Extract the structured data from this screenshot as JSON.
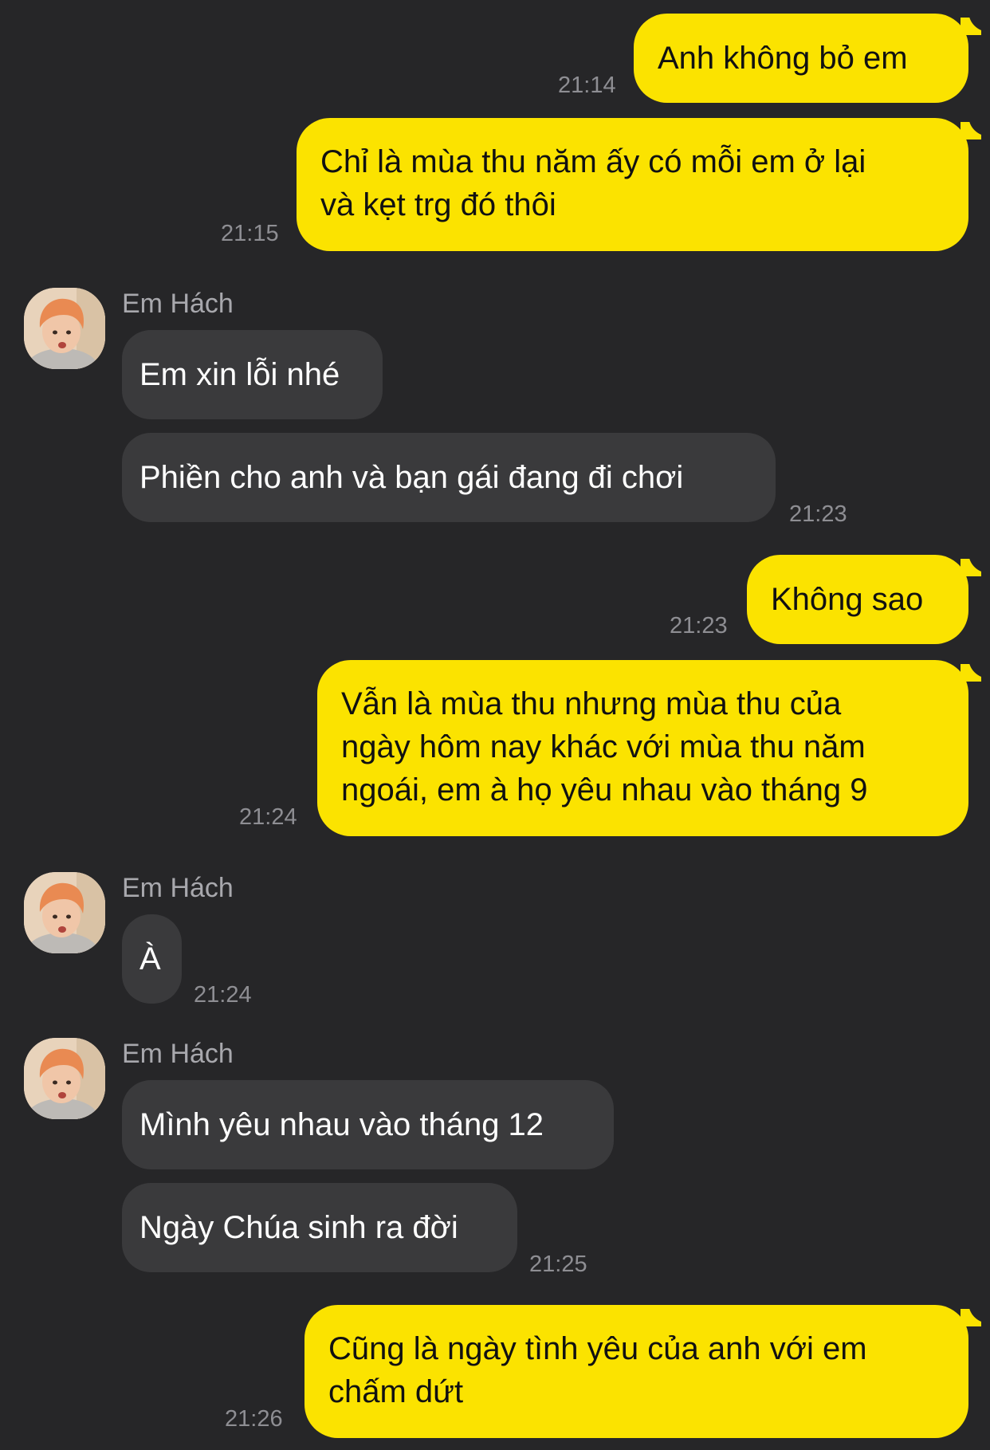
{
  "colors": {
    "background": "#262628",
    "outgoing_bubble": "#fbe300",
    "incoming_bubble": "#3a3a3c",
    "timestamp": "#8e8e93"
  },
  "contact": {
    "name": "Em Hách",
    "avatar_icon": "profile-photo-icon"
  },
  "messages": [
    {
      "from": "me",
      "lines": [
        "Anh không bỏ em"
      ],
      "time": "21:14"
    },
    {
      "from": "me",
      "lines": [
        "Chỉ là mùa thu năm ấy có mỗi em ở lại",
        "và kẹt trg đó thôi"
      ],
      "time": "21:15"
    },
    {
      "from": "contact",
      "sender": "Em Hách",
      "lines": [
        "Em xin lỗi nhé"
      ]
    },
    {
      "from": "contact",
      "lines": [
        "Phiền cho anh và bạn gái đang đi chơi"
      ],
      "time": "21:23"
    },
    {
      "from": "me",
      "lines": [
        "Không sao"
      ],
      "time": "21:23"
    },
    {
      "from": "me",
      "lines": [
        "Vẫn là mùa thu nhưng mùa thu của",
        "ngày hôm nay khác với mùa thu năm",
        "ngoái, em à họ yêu nhau vào tháng 9"
      ],
      "time": "21:24"
    },
    {
      "from": "contact",
      "sender": "Em Hách",
      "lines": [
        "À"
      ],
      "time": "21:24"
    },
    {
      "from": "contact",
      "sender": "Em Hách",
      "lines": [
        "Mình yêu nhau vào tháng 12"
      ]
    },
    {
      "from": "contact",
      "lines": [
        "Ngày Chúa sinh ra đời"
      ],
      "time": "21:25"
    },
    {
      "from": "me",
      "lines": [
        "Cũng là ngày tình yêu của anh với em",
        "chấm dứt"
      ],
      "time": "21:26"
    }
  ]
}
